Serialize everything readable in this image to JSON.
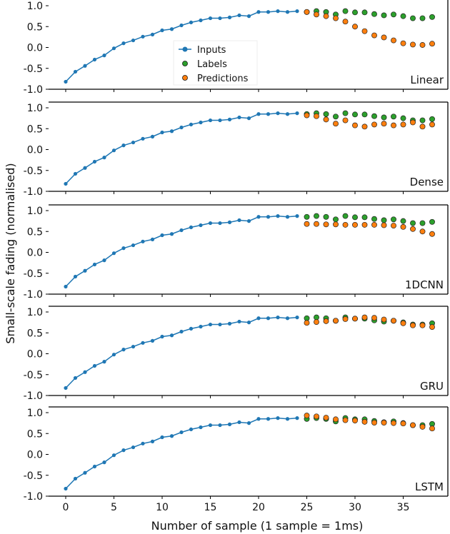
{
  "chart_data": {
    "type": "line",
    "ylabel": "Small-scale fading (normalised)",
    "xlabel": "Number of sample (1 sample = 1ms)",
    "x_ticks": [
      0,
      5,
      10,
      15,
      20,
      25,
      30,
      35
    ],
    "x_tick_labels": [
      "0",
      "5",
      "10",
      "15",
      "20",
      "25",
      "30",
      "35"
    ],
    "y_ticks": [
      1.0,
      0.5,
      0.0,
      -0.5,
      -1.0
    ],
    "y_tick_labels": [
      "1.0",
      "0.5",
      "0.0",
      "-0.5",
      "-1.0"
    ],
    "xlim": [
      -2,
      39.5
    ],
    "ylim": [
      -1.0,
      1.0
    ],
    "grid": false,
    "legend": {
      "placement": "inside first panel, center",
      "entries": [
        {
          "name": "Inputs",
          "marker": "line-dot",
          "color": "#1f77b4"
        },
        {
          "name": "Labels",
          "marker": "dot",
          "color": "#2ca02c"
        },
        {
          "name": "Predictions",
          "marker": "dot",
          "color": "#ff7f0e"
        }
      ]
    },
    "colors": {
      "inputs": "#1f77b4",
      "labels": "#2ca02c",
      "predictions": "#ff7f0e"
    },
    "inputs_x": [
      0,
      1,
      2,
      3,
      4,
      5,
      6,
      7,
      8,
      9,
      10,
      11,
      12,
      13,
      14,
      15,
      16,
      17,
      18,
      19,
      20,
      21,
      22,
      23,
      24
    ],
    "inputs": [
      -0.82,
      -0.58,
      -0.44,
      -0.29,
      -0.19,
      -0.02,
      0.1,
      0.17,
      0.26,
      0.31,
      0.41,
      0.44,
      0.53,
      0.6,
      0.65,
      0.7,
      0.7,
      0.72,
      0.77,
      0.75,
      0.85,
      0.85,
      0.87,
      0.85,
      0.87
    ],
    "labels_x": [
      25,
      26,
      27,
      28,
      29,
      30,
      31,
      32,
      33,
      34,
      35,
      36,
      37,
      38
    ],
    "labels": [
      0.85,
      0.87,
      0.85,
      0.79,
      0.87,
      0.84,
      0.84,
      0.8,
      0.77,
      0.79,
      0.75,
      0.7,
      0.7,
      0.73
    ],
    "panels": [
      {
        "name": "Linear",
        "predictions": [
          0.85,
          0.79,
          0.75,
          0.7,
          0.62,
          0.5,
          0.39,
          0.29,
          0.24,
          0.17,
          0.1,
          0.07,
          0.06,
          0.09
        ]
      },
      {
        "name": "Dense",
        "predictions": [
          0.82,
          0.8,
          0.72,
          0.62,
          0.7,
          0.58,
          0.55,
          0.6,
          0.62,
          0.58,
          0.6,
          0.65,
          0.55,
          0.6
        ]
      },
      {
        "name": "1DCNN",
        "predictions": [
          0.68,
          0.68,
          0.67,
          0.67,
          0.66,
          0.66,
          0.66,
          0.66,
          0.65,
          0.64,
          0.61,
          0.56,
          0.5,
          0.44
        ]
      },
      {
        "name": "GRU",
        "predictions": [
          0.74,
          0.76,
          0.78,
          0.79,
          0.83,
          0.84,
          0.87,
          0.86,
          0.82,
          0.79,
          0.73,
          0.68,
          0.68,
          0.64
        ]
      },
      {
        "name": "LSTM",
        "predictions": [
          0.93,
          0.91,
          0.88,
          0.84,
          0.82,
          0.81,
          0.78,
          0.76,
          0.76,
          0.75,
          0.74,
          0.7,
          0.66,
          0.62
        ]
      }
    ]
  }
}
